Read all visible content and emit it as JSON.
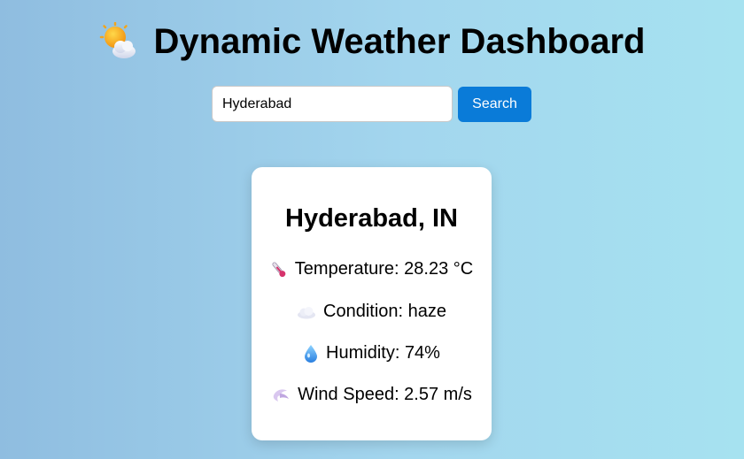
{
  "header": {
    "title": "Dynamic Weather Dashboard",
    "icon": "sun-behind-cloud-icon"
  },
  "search": {
    "value": "Hyderabad",
    "button_label": "Search",
    "button_color": "#0a7bd8"
  },
  "weather": {
    "city": "Hyderabad, IN",
    "temperature_label": "Temperature: 28.23 °C",
    "condition_label": "Condition: haze",
    "humidity_label": "Humidity: 74%",
    "wind_label": "Wind Speed: 2.57 m/s",
    "icons": [
      "thermometer-icon",
      "cloud-icon",
      "droplet-icon",
      "wind-icon"
    ]
  }
}
